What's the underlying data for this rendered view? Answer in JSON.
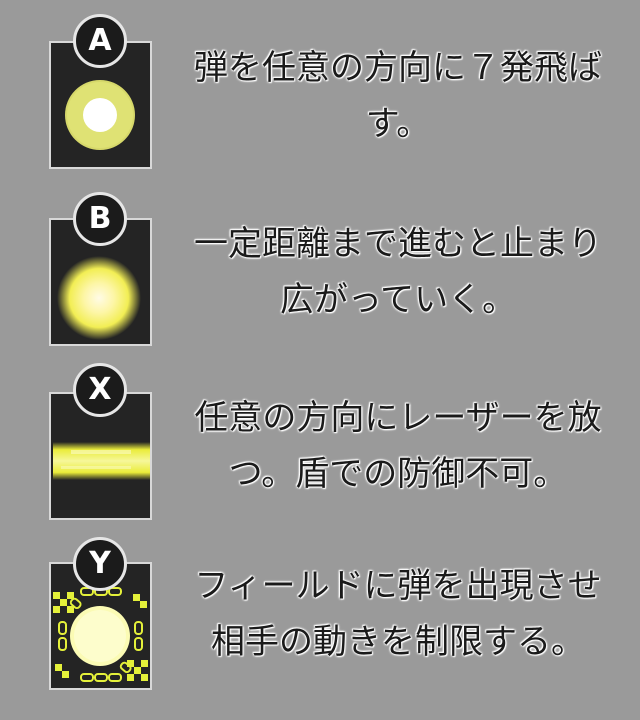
{
  "abilities": [
    {
      "button": "A",
      "line1": "弾を任意の方向に７発飛ば",
      "line2": "す。",
      "icon": "ring-bullet-icon"
    },
    {
      "button": "B",
      "line1": "一定距離まで進むと止まり",
      "line2": "広がっていく。",
      "icon": "expanding-orb-icon"
    },
    {
      "button": "X",
      "line1": "任意の方向にレーザーを放",
      "line2": "つ。盾での防御不可。",
      "icon": "laser-beam-icon"
    },
    {
      "button": "Y",
      "line1": "フィールドに弾を出現させ",
      "line2": "相手の動きを制限する。",
      "icon": "chained-field-icon"
    }
  ],
  "colors": {
    "background": "#9a9a9a",
    "card": "#242424",
    "accent": "#e9ec5a"
  }
}
